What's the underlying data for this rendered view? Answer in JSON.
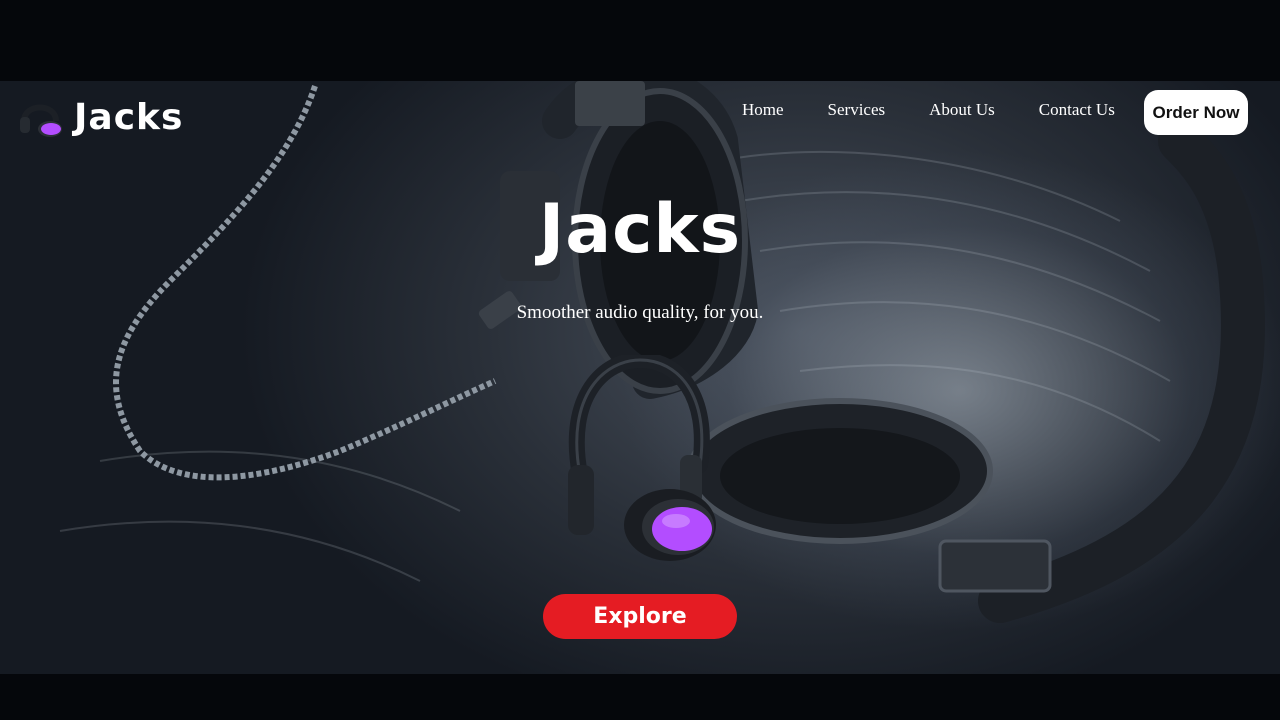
{
  "brand": {
    "name": "Jacks",
    "logo_icon": "headphones-icon"
  },
  "nav": {
    "items": [
      {
        "label": "Home"
      },
      {
        "label": "Services"
      },
      {
        "label": "About Us"
      },
      {
        "label": "Contact Us"
      }
    ],
    "order_label": "Order Now"
  },
  "hero": {
    "title": "Jacks",
    "subtitle": "Smoother audio quality, for you.",
    "cta_label": "Explore",
    "illustration_icon": "headphones-icon"
  },
  "colors": {
    "accent_purple": "#b34dff",
    "cta_red": "#e51c23",
    "background_dark": "#141922"
  }
}
